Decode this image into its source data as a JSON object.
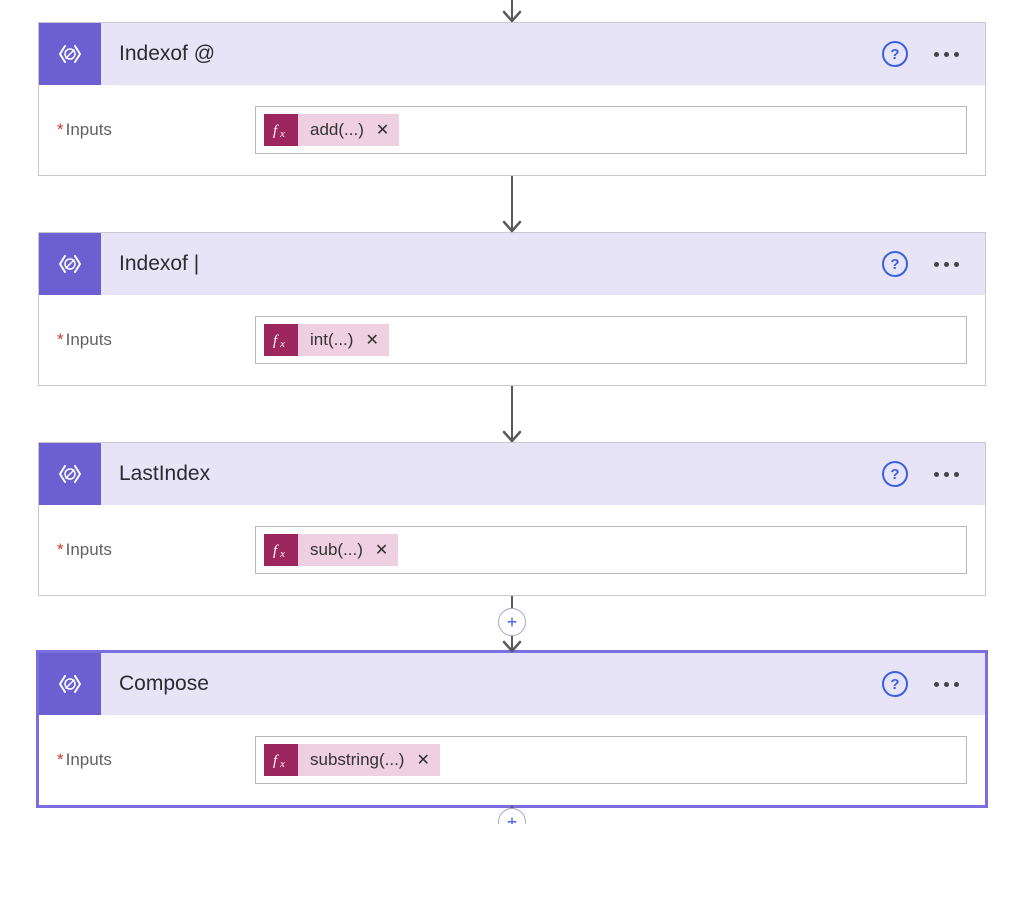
{
  "labels": {
    "inputs": "Inputs",
    "remove_token": "✕"
  },
  "icons": {
    "help": "?"
  },
  "steps": [
    {
      "id": "indexof-at",
      "title": "Indexof @",
      "token": "add(...)"
    },
    {
      "id": "indexof-pipe",
      "title": "Indexof |",
      "token": "int(...)"
    },
    {
      "id": "lastindex",
      "title": "LastIndex",
      "token": "sub(...)"
    },
    {
      "id": "compose",
      "title": "Compose",
      "token": "substring(...)",
      "selected": true,
      "plus_before": true
    }
  ]
}
